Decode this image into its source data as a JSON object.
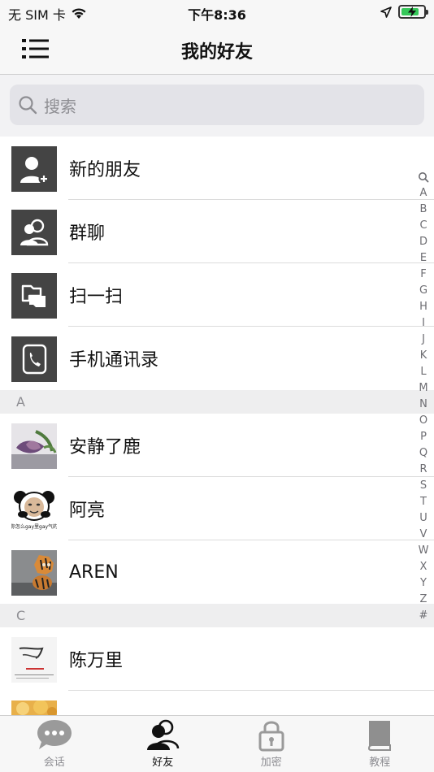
{
  "status_bar": {
    "carrier": "无 SIM 卡",
    "time": "下午8:36",
    "battery_level": 0.8,
    "colors": {
      "battery": "#35c759"
    }
  },
  "nav": {
    "title": "我的好友",
    "menu_icon": "list-icon"
  },
  "search": {
    "placeholder": "搜索",
    "icon": "search-icon"
  },
  "functions": [
    {
      "label": "新的朋友",
      "icon": "add-friend-icon"
    },
    {
      "label": "群聊",
      "icon": "group-chat-icon"
    },
    {
      "label": "扫一扫",
      "icon": "scan-icon"
    },
    {
      "label": "手机通讯录",
      "icon": "phone-contacts-icon"
    }
  ],
  "sections": [
    {
      "letter": "A",
      "contacts": [
        {
          "name": "安静了鹿"
        },
        {
          "name": "阿亮",
          "avatar_caption": "你怎么gay里gay气的"
        },
        {
          "name": "AREN"
        }
      ]
    },
    {
      "letter": "C",
      "contacts": [
        {
          "name": "陈万里"
        }
      ]
    }
  ],
  "index": [
    "A",
    "B",
    "C",
    "D",
    "E",
    "F",
    "G",
    "H",
    "I",
    "J",
    "K",
    "L",
    "M",
    "N",
    "O",
    "P",
    "Q",
    "R",
    "S",
    "T",
    "U",
    "V",
    "W",
    "X",
    "Y",
    "Z",
    "#"
  ],
  "tabs": [
    {
      "label": "会话",
      "icon": "chat-bubble-icon",
      "active": false
    },
    {
      "label": "好友",
      "icon": "friends-icon",
      "active": true
    },
    {
      "label": "加密",
      "icon": "lock-icon",
      "active": false
    },
    {
      "label": "教程",
      "icon": "book-icon",
      "active": false
    }
  ]
}
